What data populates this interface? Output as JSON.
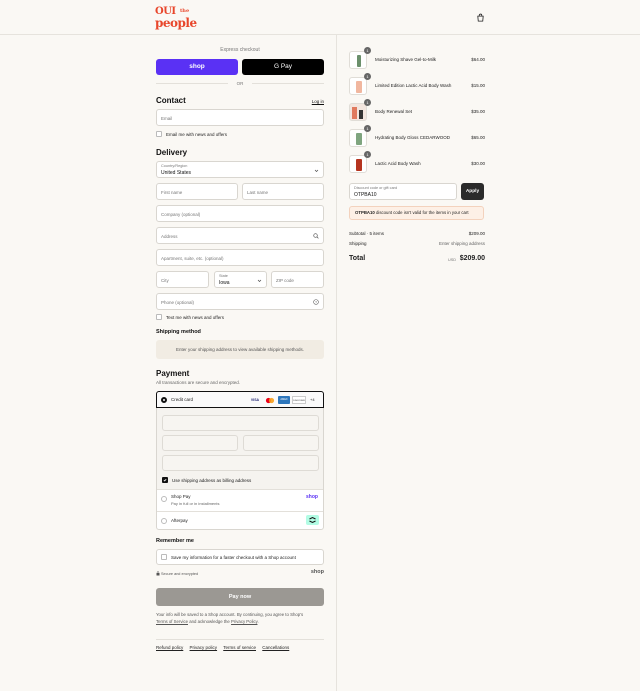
{
  "brand": {
    "line1": "OUI",
    "line1_small": "the",
    "line2": "people",
    "color": "#e8462b"
  },
  "express": {
    "title": "Express checkout",
    "shop_label": "shop",
    "gpay_label": "G Pay",
    "or": "OR"
  },
  "contact": {
    "heading": "Contact",
    "login": "Log in",
    "email_placeholder": "Email",
    "news_label": "Email me with news and offers"
  },
  "delivery": {
    "heading": "Delivery",
    "country_label": "Country/Region",
    "country_value": "United States",
    "first_name": "First name",
    "last_name": "Last name",
    "company": "Company (optional)",
    "address": "Address",
    "apartment": "Apartment, suite, etc. (optional)",
    "city": "City",
    "state_label": "State",
    "state_value": "Iowa",
    "zip": "ZIP code",
    "phone": "Phone (optional)",
    "text_label": "Text me with news and offers"
  },
  "shipping": {
    "heading": "Shipping method",
    "notice": "Enter your shipping address to view available shipping methods."
  },
  "payment": {
    "heading": "Payment",
    "secure_note": "All transactions are secure and encrypted.",
    "credit_card": "Credit card",
    "card_brands": [
      "VISA",
      "MC",
      "AMEX",
      "DISCOVER",
      "+4"
    ],
    "billing_label": "Use shipping address as billing address",
    "shop_pay": "Shop Pay",
    "shop_pay_sub": "Pay in full or in installments",
    "shop_pay_logo": "shop",
    "afterpay": "Afterpay"
  },
  "remember": {
    "heading": "Remember me",
    "label": "Save my information for a faster checkout with a Shop account",
    "secure": "Secure and encrypted",
    "shop_logo": "shop"
  },
  "pay_button": "Pay now",
  "legal": {
    "text": "Your info will be saved to a Shop account. By continuing, you agree to Shop's",
    "terms": "Terms of Service",
    "and": "and acknowledge the",
    "privacy": "Privacy Policy",
    "end": "."
  },
  "footer_links": [
    "Refund policy",
    "Privacy policy",
    "Terms of service",
    "Cancellations"
  ],
  "cart": {
    "items": [
      {
        "name": "Moisturizing Shave Gel-to-Milk",
        "price": "$64.00",
        "qty": "1"
      },
      {
        "name": "Limited Edition Lactic Acid Body Wash",
        "price": "$15.00",
        "qty": "1"
      },
      {
        "name": "Body Renewal Set",
        "price": "$35.00",
        "qty": "1"
      },
      {
        "name": "Hydrating Body Gloss CEDARWOOD",
        "price": "$65.00",
        "qty": "1"
      },
      {
        "name": "Lactic Acid Body Wash",
        "price": "$30.00",
        "qty": "1"
      }
    ],
    "discount_label": "Discount code or gift card",
    "discount_value": "OTPBA10",
    "apply": "Apply",
    "error_code": "OTPBA10",
    "error_text": "discount code isn't valid for the items in your cart",
    "subtotal_label": "Subtotal · 5 items",
    "subtotal": "$209.00",
    "shipping_label": "Shipping",
    "shipping_value": "Enter shipping address",
    "total_label": "Total",
    "currency": "USD",
    "total": "$209.00"
  },
  "colors": {
    "shop_purple": "#5a31f4",
    "accent_red": "#e8462b",
    "pay_button_gray": "#9b9893"
  }
}
